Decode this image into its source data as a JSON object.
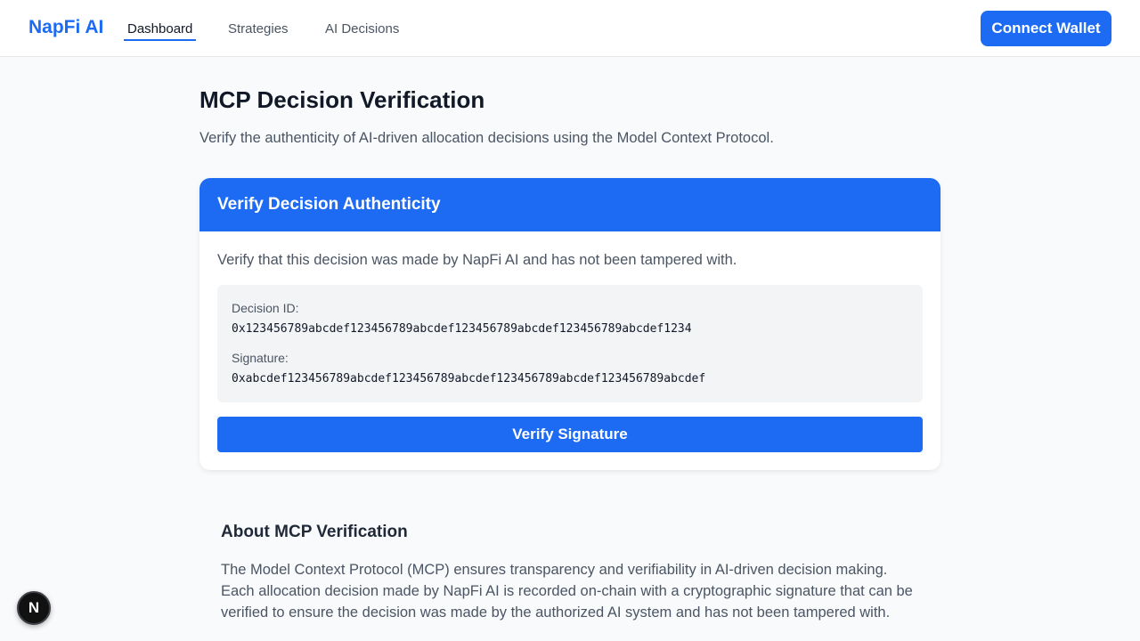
{
  "nav": {
    "brand": "NapFi AI",
    "links": [
      "Dashboard",
      "Strategies",
      "AI Decisions"
    ],
    "active": "Dashboard",
    "connect_label": "Connect Wallet"
  },
  "page": {
    "title": "MCP Decision Verification",
    "subtitle": "Verify the authenticity of AI-driven allocation decisions using the Model Context Protocol."
  },
  "card": {
    "title": "Verify Decision Authenticity",
    "description": "Verify that this decision was made by NapFi AI and has not been tampered with.",
    "decision_id_label": "Decision ID:",
    "decision_id": "0x123456789abcdef123456789abcdef123456789abcdef123456789abcdef1234",
    "signature_label": "Signature:",
    "signature": "0xabcdef123456789abcdef123456789abcdef123456789abcdef123456789abcdef",
    "verify_label": "Verify Signature"
  },
  "about": {
    "title": "About MCP Verification",
    "text": "The Model Context Protocol (MCP) ensures transparency and verifiability in AI-driven decision making. Each allocation decision made by NapFi AI is recorded on-chain with a cryptographic signature that can be verified to ensure the decision was made by the authorized AI system and has not been tampered with."
  },
  "badge": {
    "letter": "N",
    "icon": "nextjs-logo-icon"
  },
  "colors": {
    "accent": "#1d6bf3",
    "background": "#f8fafc"
  }
}
